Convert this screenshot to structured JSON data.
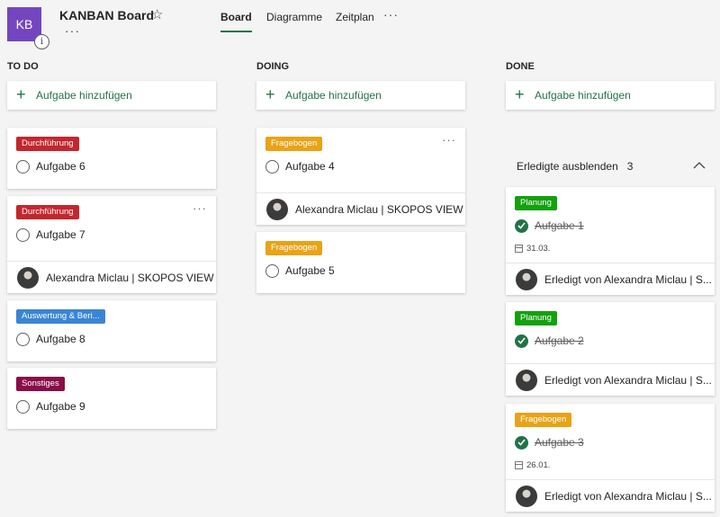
{
  "header": {
    "plan_initials": "KB",
    "title": "KANBAN Board",
    "tabs": [
      "Board",
      "Diagramme",
      "Zeitplan"
    ],
    "active_tab": "Board",
    "plan_color": "#7346c0"
  },
  "columns": {
    "todo": {
      "title": "TO DO",
      "add_label": "Aufgabe hinzufügen",
      "cards": [
        {
          "label": "Durchführung",
          "label_color": "#c4262e",
          "title": "Aufgabe 6"
        },
        {
          "label": "Durchführung",
          "label_color": "#c4262e",
          "title": "Aufgabe 7",
          "assignee": "Alexandra Miclau | SKOPOS VIEW"
        },
        {
          "label": "Auswertung & Beri...",
          "label_color": "#3a85d3",
          "title": "Aufgabe 8"
        },
        {
          "label": "Sonstiges",
          "label_color": "#8a0d48",
          "title": "Aufgabe 9"
        }
      ]
    },
    "doing": {
      "title": "DOING",
      "add_label": "Aufgabe hinzufügen",
      "cards": [
        {
          "label": "Fragebogen",
          "label_color": "#e8a317",
          "title": "Aufgabe 4",
          "assignee": "Alexandra Miclau | SKOPOS VIEW"
        },
        {
          "label": "Fragebogen",
          "label_color": "#e8a317",
          "title": "Aufgabe 5"
        }
      ]
    },
    "done": {
      "title": "DONE",
      "add_label": "Aufgabe hinzufügen",
      "completed_toggle_label": "Erledigte ausblenden",
      "completed_count": "3",
      "cards": [
        {
          "label": "Planung",
          "label_color": "#13a10e",
          "title": "Aufgabe 1",
          "due": "31.03.",
          "completed_by": "Erledigt von Alexandra Miclau | S..."
        },
        {
          "label": "Planung",
          "label_color": "#13a10e",
          "title": "Aufgabe 2",
          "completed_by": "Erledigt von Alexandra Miclau | S..."
        },
        {
          "label": "Fragebogen",
          "label_color": "#e8a317",
          "title": "Aufgabe 3",
          "due": "26.01.",
          "completed_by": "Erledigt von Alexandra Miclau | S..."
        }
      ]
    }
  }
}
